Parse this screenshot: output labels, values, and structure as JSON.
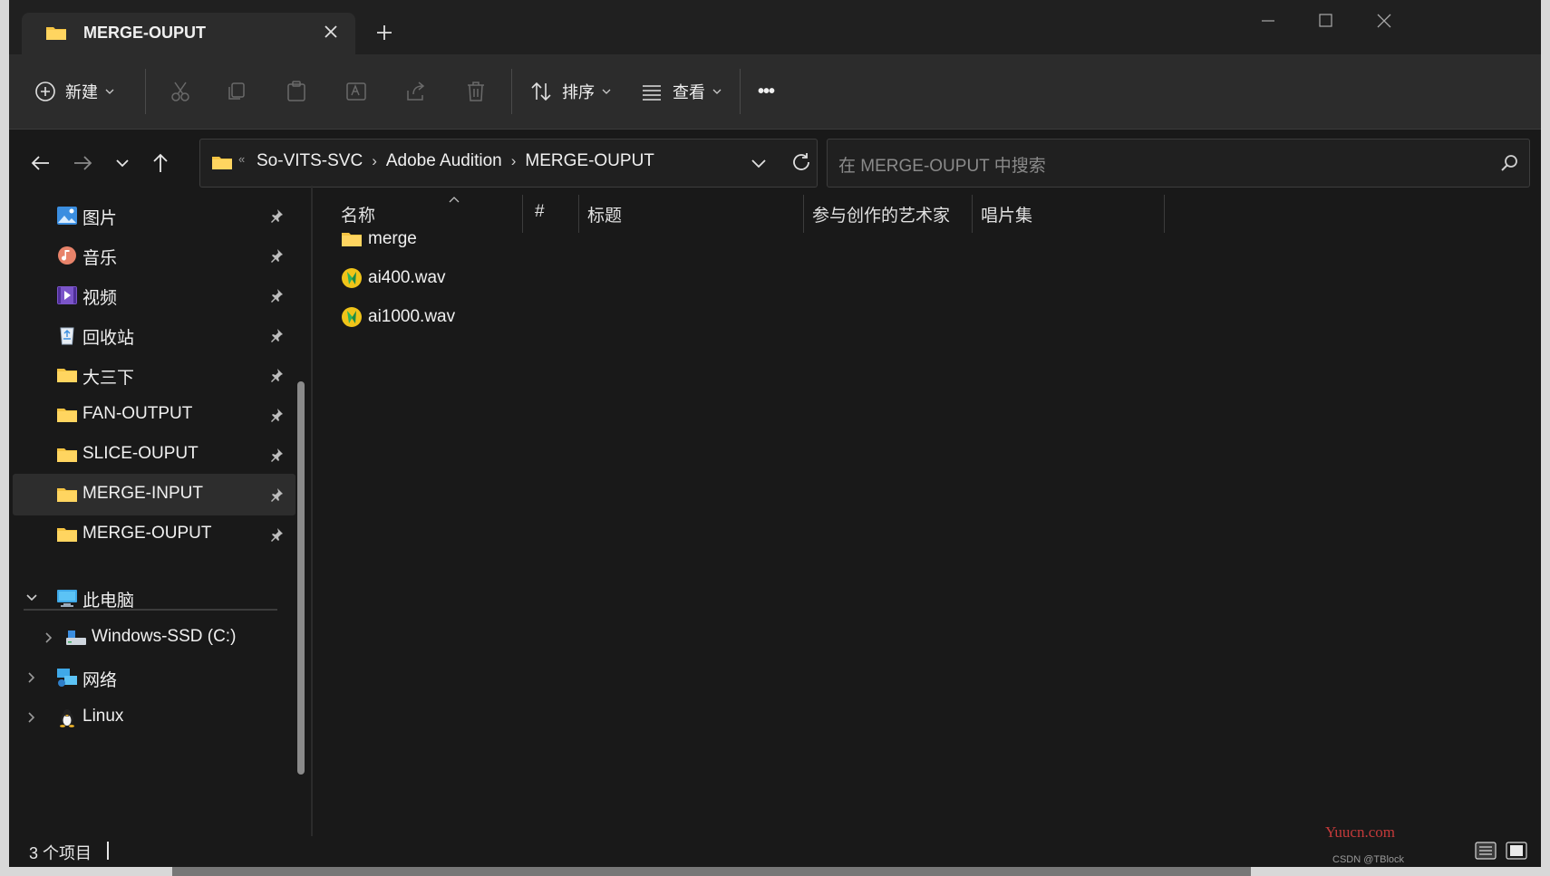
{
  "window": {
    "tab_title": "MERGE-OUPUT"
  },
  "toolbar": {
    "new_label": "新建",
    "sort_label": "排序",
    "view_label": "查看",
    "more_label": "•••"
  },
  "address": {
    "crumbs": [
      "So-VITS-SVC",
      "Adobe Audition",
      "MERGE-OUPUT"
    ],
    "separator": "›",
    "overflow": "«"
  },
  "search": {
    "placeholder": "在 MERGE-OUPUT 中搜索"
  },
  "sidebar": {
    "pinned": [
      {
        "label": "图片",
        "icon": "pictures-icon"
      },
      {
        "label": "音乐",
        "icon": "music-icon"
      },
      {
        "label": "视频",
        "icon": "videos-icon"
      },
      {
        "label": "回收站",
        "icon": "recycle-bin-icon"
      },
      {
        "label": "大三下",
        "icon": "folder-icon"
      },
      {
        "label": "FAN-OUTPUT",
        "icon": "folder-icon"
      },
      {
        "label": "SLICE-OUPUT",
        "icon": "folder-icon"
      },
      {
        "label": "MERGE-INPUT",
        "icon": "folder-icon",
        "selected": true
      },
      {
        "label": "MERGE-OUPUT",
        "icon": "folder-icon"
      }
    ],
    "tree": [
      {
        "label": "此电脑",
        "icon": "this-pc-icon",
        "expanded": true
      },
      {
        "label": "Windows-SSD (C:)",
        "icon": "drive-icon"
      },
      {
        "label": "网络",
        "icon": "network-icon"
      },
      {
        "label": "Linux",
        "icon": "linux-icon"
      }
    ]
  },
  "columns": [
    "名称",
    "#",
    "标题",
    "参与创作的艺术家",
    "唱片集"
  ],
  "files": [
    {
      "name": "merge",
      "icon": "folder-icon"
    },
    {
      "name": "ai400.wav",
      "icon": "audio-file-icon"
    },
    {
      "name": "ai1000.wav",
      "icon": "audio-file-icon"
    }
  ],
  "status": {
    "item_count": "3 个项目"
  },
  "watermark": {
    "site": "Yuucn.com",
    "credit": "CSDN @TBlock"
  },
  "colors": {
    "background": "#191919",
    "toolbar": "#2c2c2c",
    "folder": "#f5c443",
    "accent": "#4aa3e0"
  }
}
